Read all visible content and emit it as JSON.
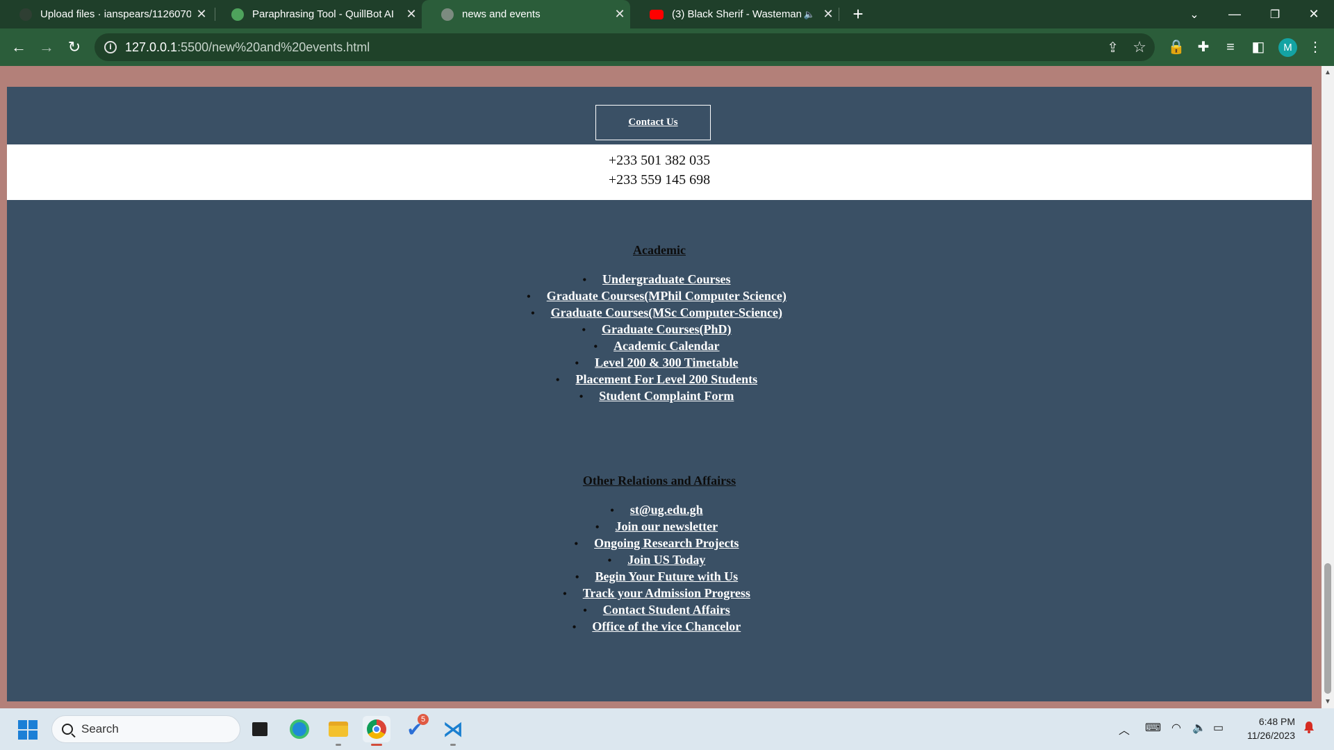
{
  "browser": {
    "tabs": [
      {
        "title": "Upload files · ianspears/1126070",
        "favicon_color": "#2f3f33",
        "active": false
      },
      {
        "title": "Paraphrasing Tool - QuillBot AI",
        "favicon_color": "#4ea25c",
        "active": false
      },
      {
        "title": "news and events",
        "favicon_color": "#7c8b80",
        "active": true
      },
      {
        "title": "(3) Black Sherif - Wasteman",
        "favicon_color": "#ff0000",
        "active": false
      }
    ],
    "url_host": "127.0.0.1",
    "url_rest": ":5500/new%20and%20events.html",
    "profile_initial": "M"
  },
  "page": {
    "contact_button": "Contact Us",
    "phones": [
      "+233 501 382 035",
      "+233 559 145 698"
    ],
    "academic": {
      "title": "Academic",
      "links": [
        "Undergraduate Courses",
        "Graduate Courses(MPhil Computer Science)",
        "Graduate Courses(MSc Computer-Science)",
        "Graduate Courses(PhD)",
        "Academic Calendar",
        "Level 200 & 300 Timetable",
        "Placement For Level 200 Students",
        "Student Complaint Form"
      ]
    },
    "relations": {
      "title": "Other Relations and Affairss",
      "links": [
        "st@ug.edu.gh",
        "Join our newsletter",
        "Ongoing Research Projects",
        "Join US Today",
        "Begin Your Future with Us",
        "Track your Admission Progress",
        "Contact Student Affairs",
        "Office of the vice Chancelor"
      ]
    },
    "colors": {
      "navy": "#3a5065",
      "page_bg": "#b38079",
      "link": "#ffffff"
    }
  },
  "taskbar": {
    "search_label": "Search",
    "todo_badge": "5",
    "time": "6:48 PM",
    "date": "11/26/2023"
  }
}
